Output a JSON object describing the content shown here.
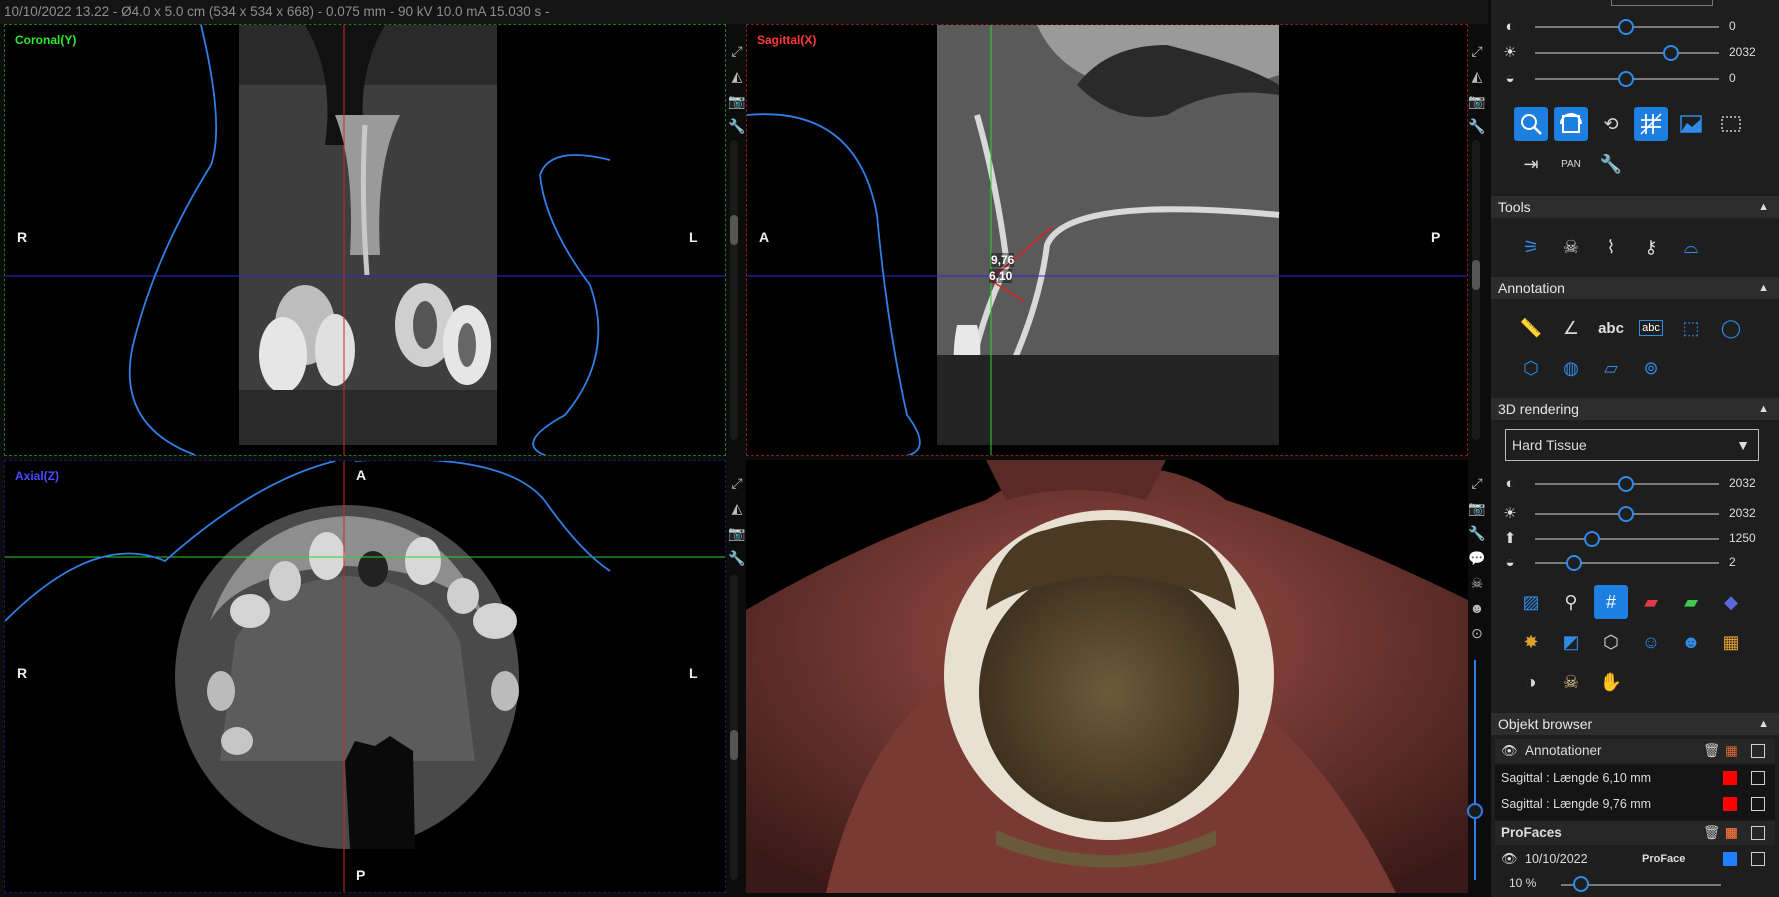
{
  "header": {
    "text": "10/10/2022 13.22 - Ø4.0 x 5.0 cm (534 x 534 x 668) - 0.075 mm - 90 kV 10.0 mA 15.030 s -"
  },
  "views": {
    "coronal": {
      "title": "Coronal(Y)",
      "left": "R",
      "right": "L"
    },
    "sagittal": {
      "title": "Sagittal(X)",
      "left": "A",
      "right": "P",
      "meas1": "9,76",
      "meas2": "6,10"
    },
    "axial": {
      "title": "Axial(Z)",
      "top": "A",
      "bottom": "P",
      "left": "R",
      "right": "L"
    }
  },
  "panel": {
    "top_sliders": [
      {
        "icon": "contrast-icon",
        "value": "0"
      },
      {
        "icon": "brightness-icon",
        "value": "2032"
      },
      {
        "icon": "gamma-icon",
        "value": "0"
      }
    ],
    "tools_header": "Tools",
    "annotation_header": "Annotation",
    "rendering_header": "3D rendering",
    "rendering_select": "Hard Tissue",
    "render_sliders": [
      {
        "icon": "contrast-icon",
        "value": "2032"
      },
      {
        "icon": "brightness-icon",
        "value": "2032"
      },
      {
        "icon": "threshold-up-icon",
        "value": "1250"
      },
      {
        "icon": "gamma-icon",
        "value": "2"
      }
    ],
    "browser_header": "Objekt browser",
    "annotations_group": "Annotationer",
    "annotations": [
      {
        "text": "Sagittal : Længde 6,10 mm",
        "color": "#ff0000"
      },
      {
        "text": "Sagittal : Længde 9,76 mm",
        "color": "#ff0000"
      }
    ],
    "proface_group": "ProFaces",
    "proface_item": {
      "date": "10/10/2022",
      "name": "ProFace",
      "color": "#1f7fff"
    },
    "opacity": "10 %"
  },
  "colors": {
    "accent": "#1d7fe0",
    "coronal": "#2ee82e",
    "sagittal": "#ff2a2a",
    "axial": "#3a3aff"
  }
}
